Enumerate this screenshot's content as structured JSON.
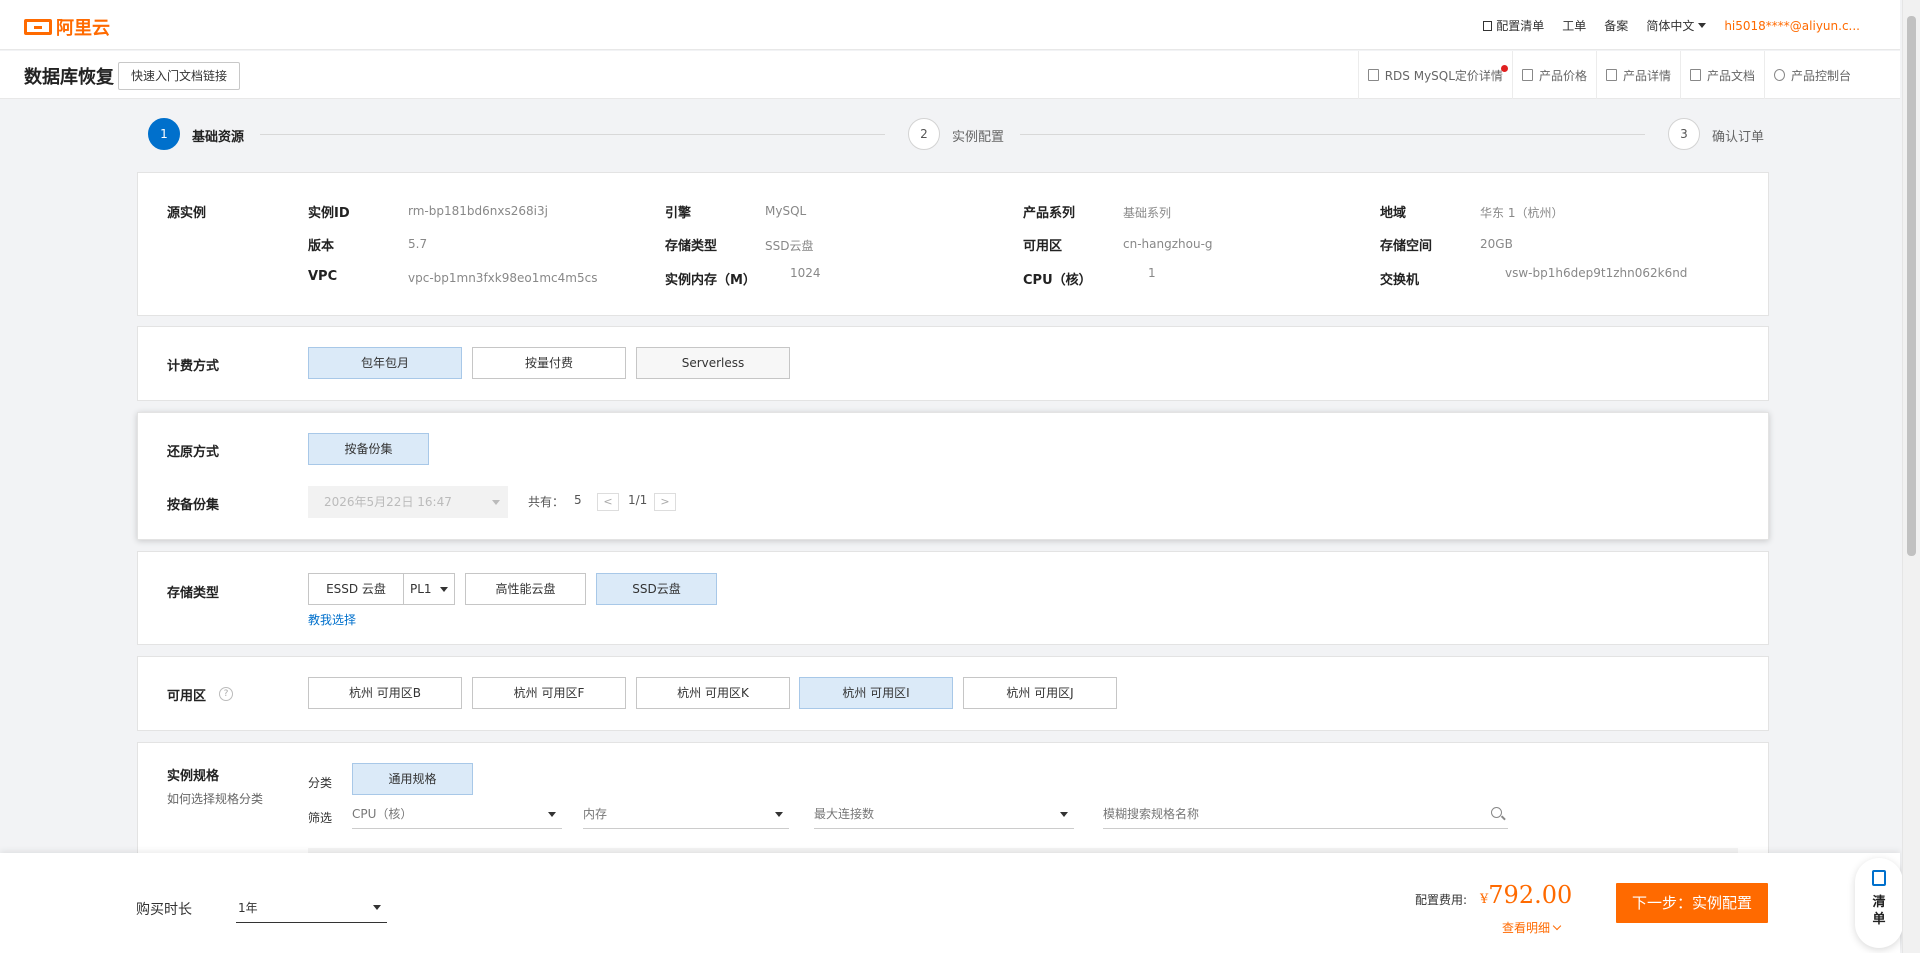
{
  "brand": {
    "name": "阿里云",
    "color": "#ff6a00",
    "accent": "#0070cc"
  },
  "topnav": {
    "config_list": "配置清单",
    "ticket": "工单",
    "record": "备案",
    "language": "简体中文",
    "user": "hi5018****@aliyun.c..."
  },
  "page": {
    "title": "数据库恢复",
    "quick_link": "快速入门文档链接"
  },
  "head_links": [
    {
      "label": "RDS MySQL定价详情",
      "icon": "external-link-icon",
      "badge": true
    },
    {
      "label": "产品价格",
      "icon": "price-icon"
    },
    {
      "label": "产品详情",
      "icon": "detail-icon"
    },
    {
      "label": "产品文档",
      "icon": "doc-icon"
    },
    {
      "label": "产品控制台",
      "icon": "console-icon"
    }
  ],
  "steps": [
    {
      "num": "1",
      "label": "基础资源",
      "active": true
    },
    {
      "num": "2",
      "label": "实例配置",
      "active": false
    },
    {
      "num": "3",
      "label": "确认订单",
      "active": false
    }
  ],
  "source": {
    "title": "源实例",
    "instance_id": {
      "key": "实例ID",
      "value": "rm-bp181bd6nxs268i3j"
    },
    "engine": {
      "key": "引擎",
      "value": "MySQL"
    },
    "series": {
      "key": "产品系列",
      "value": "基础系列"
    },
    "region": {
      "key": "地域",
      "value": "华东 1（杭州）"
    },
    "version": {
      "key": "版本",
      "value": "5.7"
    },
    "storage_type": {
      "key": "存储类型",
      "value": "SSD云盘"
    },
    "zone": {
      "key": "可用区",
      "value": "cn-hangzhou-g"
    },
    "storage": {
      "key": "存储空间",
      "value": "20GB"
    },
    "vpc": {
      "key": "VPC",
      "value": "vpc-bp1mn3fxk98eo1mc4m5cs"
    },
    "memory": {
      "key": "实例内存（M）",
      "value": "1024"
    },
    "cpu": {
      "key": "CPU（核）",
      "value": "1"
    },
    "vswitch": {
      "key": "交换机",
      "value": "vsw-bp1h6dep9t1zhn062k6nd"
    }
  },
  "billing": {
    "title": "计费方式",
    "options": [
      "包年包月",
      "按量付费",
      "Serverless"
    ],
    "selected": "包年包月"
  },
  "restore": {
    "title": "还原方式",
    "option": "按备份集",
    "backup_title": "按备份集",
    "backup_date": "2026年5月22日 16:47",
    "total_label": "共有：",
    "total": "5",
    "page": "1/1"
  },
  "storage_type": {
    "title": "存储类型",
    "options": [
      "ESSD 云盘",
      "PL1",
      "高性能云盘",
      "SSD云盘"
    ],
    "selected": "SSD云盘",
    "help_link": "教我选择"
  },
  "zone": {
    "title": "可用区",
    "options": [
      "杭州 可用区B",
      "杭州 可用区F",
      "杭州 可用区K",
      "杭州 可用区I",
      "杭州 可用区J"
    ],
    "selected": "杭州 可用区I"
  },
  "spec": {
    "title": "实例规格",
    "subtitle": "如何选择规格分类",
    "category_label": "分类",
    "category": "通用规格",
    "filter_label": "筛选",
    "filter_cpu": "CPU（核）",
    "filter_mem": "内存",
    "filter_conn": "最大连接数",
    "search_placeholder": "模糊搜索规格名称"
  },
  "footer": {
    "duration_label": "购买时长",
    "duration": "1年",
    "fee_label": "配置费用:",
    "currency": "¥",
    "fee": "792.00",
    "detail": "查看明细",
    "next": "下一步：实例配置",
    "cart": "清单"
  }
}
